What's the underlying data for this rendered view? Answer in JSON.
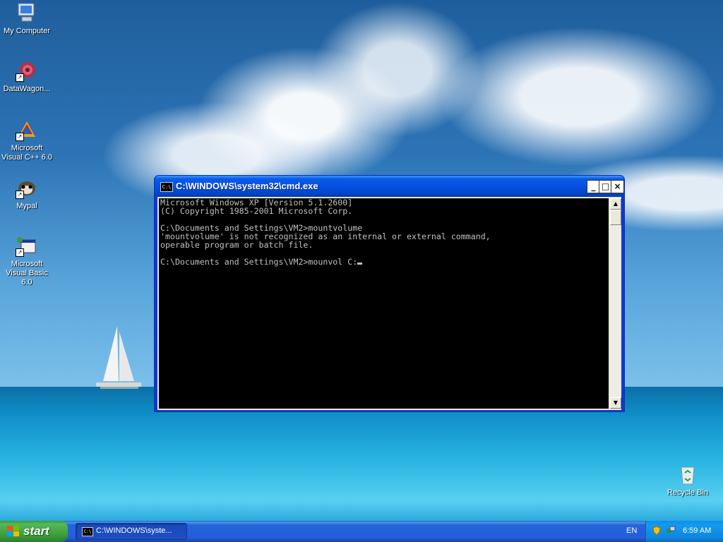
{
  "desktop": {
    "icons": [
      {
        "label": "My Computer"
      },
      {
        "label": "DataWagon..."
      },
      {
        "label": "Microsoft Visual C++ 6.0"
      },
      {
        "label": "Mypal"
      },
      {
        "label": "Microsoft Visual Basic 6.0"
      },
      {
        "label": "Recycle Bin"
      }
    ]
  },
  "cmd_window": {
    "title": "C:\\WINDOWS\\system32\\cmd.exe",
    "icon_text": "C:\\",
    "buttons": {
      "minimize": "_",
      "maximize": "□",
      "close": "×"
    },
    "lines": [
      "Microsoft Windows XP [Version 5.1.2600]",
      "(C) Copyright 1985-2001 Microsoft Corp.",
      "",
      "C:\\Documents and Settings\\VM2>mountvolume",
      "'mountvolume' is not recognized as an internal or external command,",
      "operable program or batch file.",
      "",
      "C:\\Documents and Settings\\VM2>mounvol C:"
    ]
  },
  "taskbar": {
    "start_label": "start",
    "task_label": "C:\\WINDOWS\\syste...",
    "language": "EN",
    "clock": "6:59 AM"
  },
  "colors": {
    "console_bg": "#000000",
    "console_text": "#c0c0c0",
    "titlebar": "#0451e0",
    "taskbar": "#245edb",
    "start_button": "#3ea33e"
  }
}
